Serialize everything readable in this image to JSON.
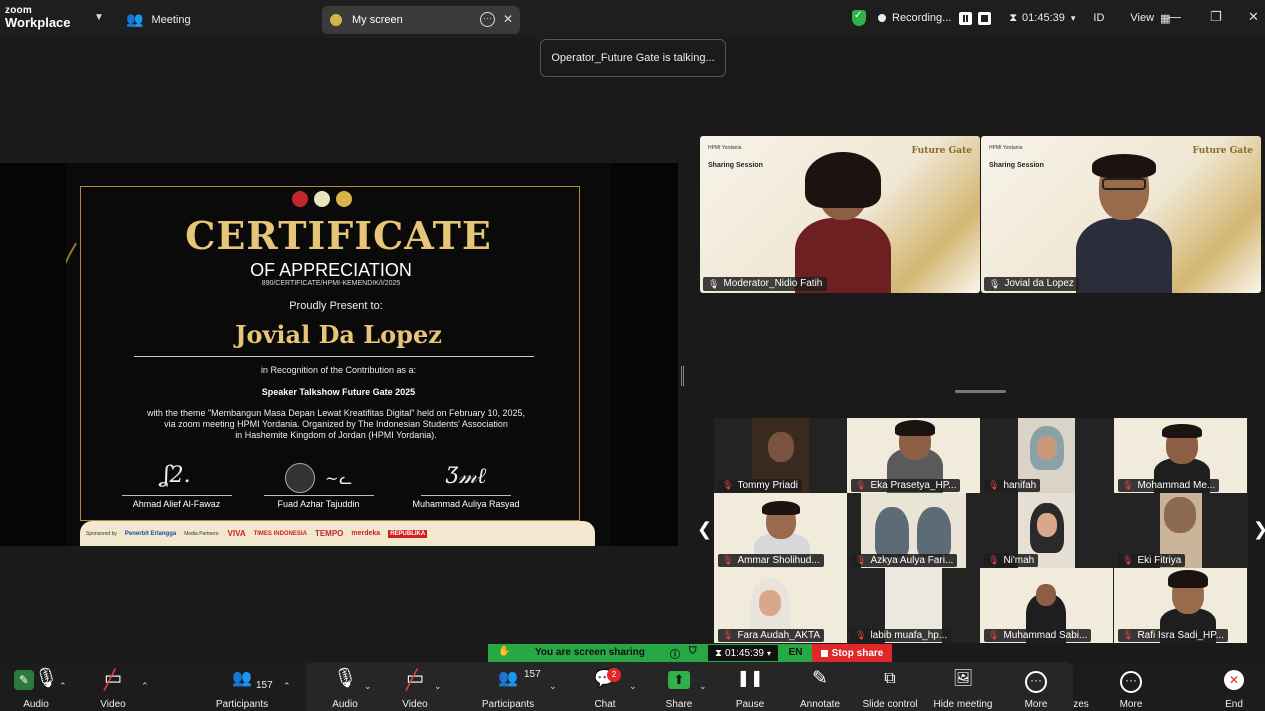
{
  "app": {
    "logo_line1": "zoom",
    "logo_line2": "Workplace"
  },
  "topbar": {
    "meeting_label": "Meeting",
    "share_tab_label": "My screen",
    "recording_label": "Recording...",
    "timer": "01:45:39",
    "lang": "ID",
    "view_label": "View"
  },
  "talking_toast": "Operator_Future Gate is talking...",
  "certificate": {
    "title": "CERTIFICATE",
    "subtitle": "OF APPRECIATION",
    "number": "890/CERTIFICATE/HPMI-KEMENDIK/I/2025",
    "present": "Proudly Present to:",
    "recipient": "Jovial Da Lopez",
    "recognition": "in Recognition of the Contribution as a:",
    "role": "Speaker Talkshow Future Gate 2025",
    "body_line1": "with the theme \"Membangun Masa Depan Lewat Kreatifitas Digital\" held on February 10, 2025,",
    "body_line2": "via zoom meeting HPMI Yordania. Organized by The Indonesian Students' Association",
    "body_line3": "in Hashemite Kingdom of Jordan (HPMI Yordania).",
    "signers": [
      "Ahmad Alief Al-Fawaz",
      "Fuad Azhar Tajuddin",
      "Muhammad Auliya Rasyad"
    ],
    "sponsor_text": [
      "Sponsored by",
      "Penerbit Erlangga",
      "Media Partners:",
      "VIVA",
      "TIMES INDONESIA",
      "TEMPO",
      "merdeka",
      "REPUBLIKA"
    ]
  },
  "speakers": [
    {
      "name": "Moderator_Nidio Fatih",
      "banner_title": "Sharing Session",
      "org": "HPMI Yordania",
      "brand": "Future Gate"
    },
    {
      "name": "Jovial da Lopez",
      "banner_title": "Sharing Session",
      "org": "HPMI Yordania",
      "brand": "Future Gate"
    }
  ],
  "gallery": [
    {
      "name": "Tommy Priadi"
    },
    {
      "name": "Eka Prasetya_HP..."
    },
    {
      "name": "hanifah"
    },
    {
      "name": "Mohammad Me..."
    },
    {
      "name": "Ammar Sholihud..."
    },
    {
      "name": "Azkya Aulya Fari..."
    },
    {
      "name": "Ni'mah"
    },
    {
      "name": "Eki Fitriya"
    },
    {
      "name": "Fara Audah_AKTA"
    },
    {
      "name": "labib muafa_hp..."
    },
    {
      "name": "Muhammad Sabi..."
    },
    {
      "name": "Rafi Isra Sadi_HP..."
    }
  ],
  "sharebar": {
    "status": "You are screen sharing",
    "timer": "01:45:39",
    "lang": "EN",
    "stop_label": "Stop share"
  },
  "toolbar": {
    "audio": "Audio",
    "video": "Video",
    "participants": "Participants",
    "participants_count": "157",
    "chat": "Chat",
    "chat_badge": "2",
    "share": "Share",
    "pause": "Pause",
    "annotate": "Annotate",
    "slide_control": "Slide control",
    "hide_meeting": "Hide meeting",
    "more": "More",
    "reactions_partial": "zes",
    "end": "End"
  }
}
